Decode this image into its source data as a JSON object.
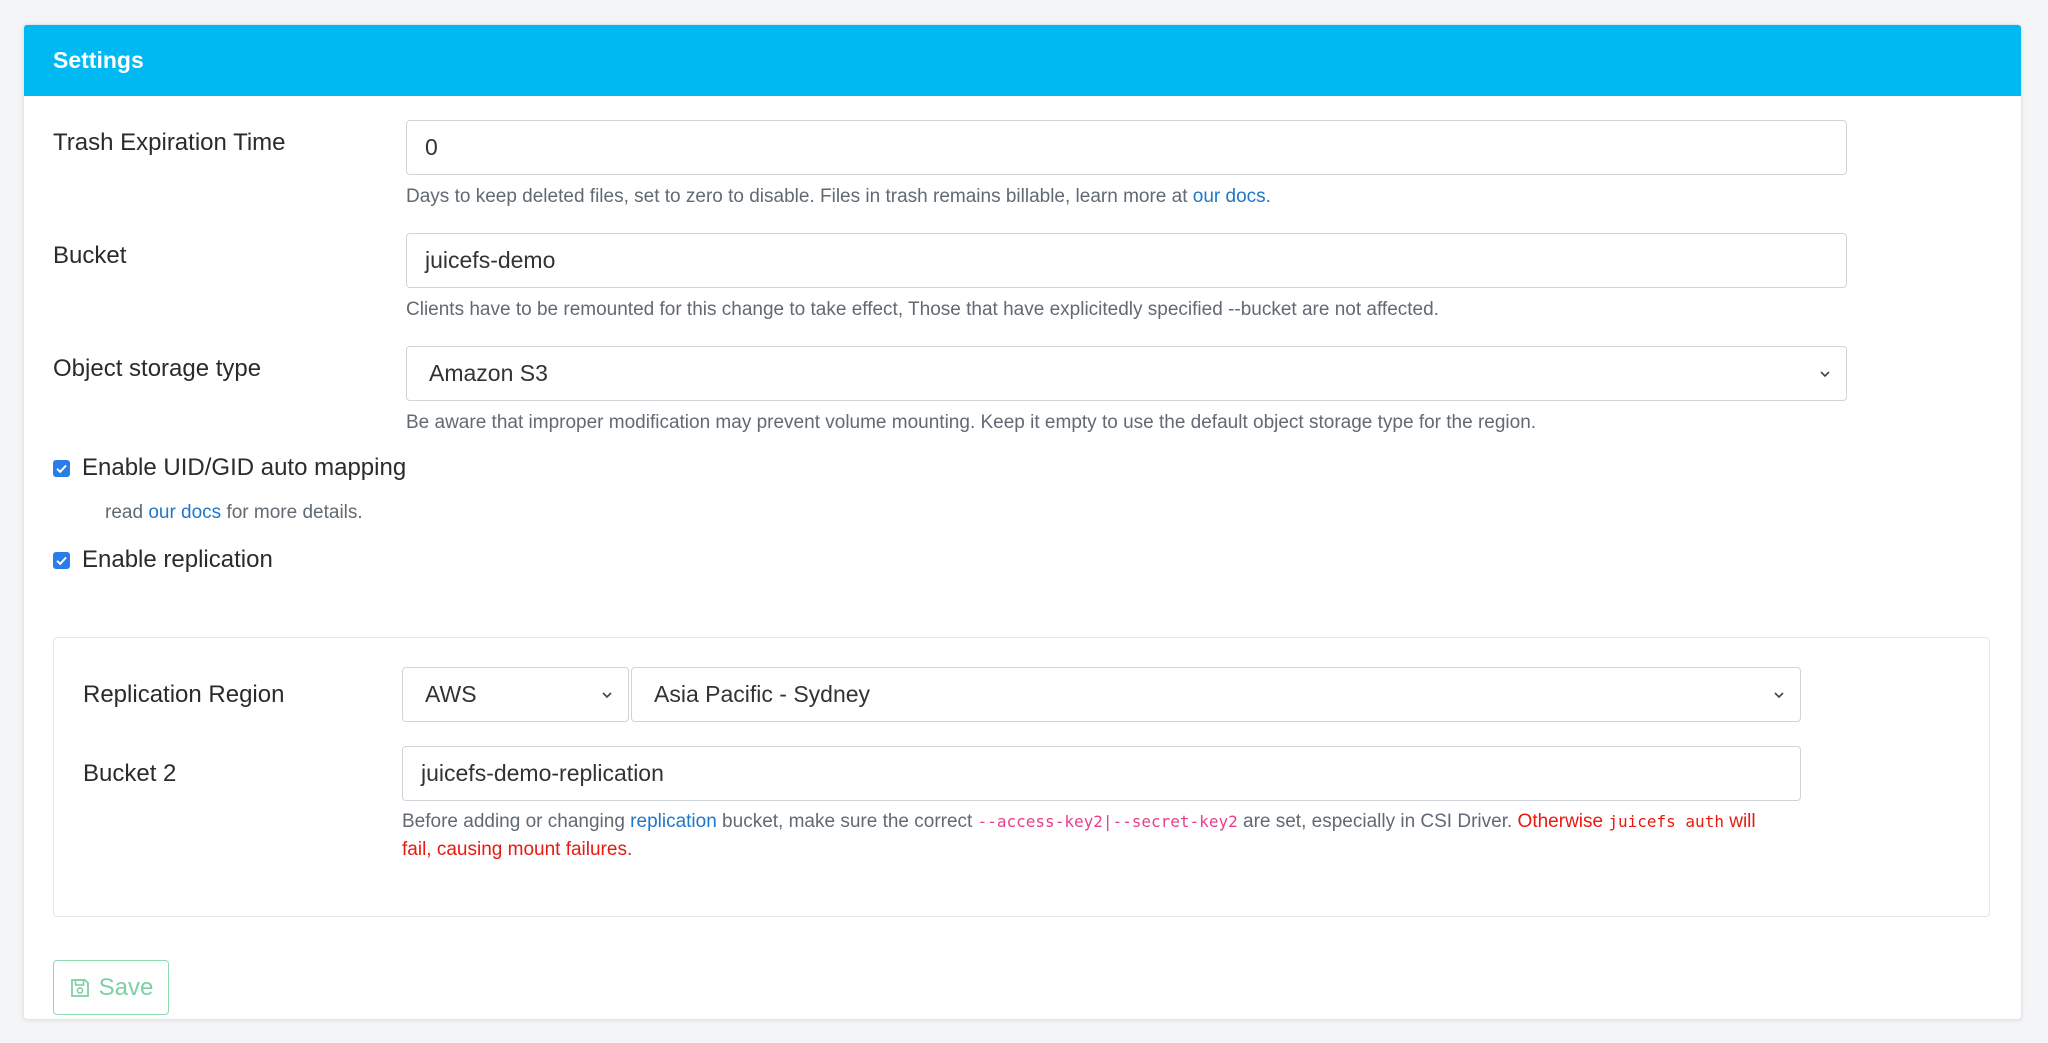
{
  "header": {
    "title": "Settings"
  },
  "trash": {
    "label": "Trash Expiration Time",
    "value": "0",
    "help_prefix": "Days to keep deleted files, set to zero to disable. Files in trash remains billable, learn more at ",
    "help_link": "our docs",
    "help_suffix": "."
  },
  "bucket": {
    "label": "Bucket",
    "value": "juicefs-demo",
    "help": "Clients have to be remounted for this change to take effect, Those that have explicitedly specified --bucket are not affected."
  },
  "storage_type": {
    "label": "Object storage type",
    "selected": "Amazon S3",
    "help": "Be aware that improper modification may prevent volume mounting. Keep it empty to use the default object storage type for the region."
  },
  "uid_mapping": {
    "checked": true,
    "label": "Enable UID/GID auto mapping",
    "help_prefix": "read ",
    "help_link": "our docs",
    "help_suffix": " for more details."
  },
  "replication": {
    "checked": true,
    "label": "Enable replication",
    "region_label": "Replication Region",
    "provider_selected": "AWS",
    "region_selected": "Asia Pacific - Sydney",
    "bucket2_label": "Bucket 2",
    "bucket2_value": "juicefs-demo-replication",
    "help_1": "Before adding or changing ",
    "help_link": "replication",
    "help_2": " bucket, make sure the correct ",
    "help_code": "--access-key2|--secret-key2",
    "help_3": " are set, especially in CSI Driver. ",
    "warn_1": "Otherwise ",
    "warn_code": "juicefs auth",
    "warn_2": " will fail, causing mount failures."
  },
  "save": {
    "label": "Save",
    "icon": "save-icon"
  },
  "colors": {
    "header": "#00b9f2",
    "link": "#1f77c9",
    "checkbox": "#2b7de9",
    "warning": "#e8190f",
    "code": "#e83e8c",
    "save": "#7fcfa4"
  }
}
